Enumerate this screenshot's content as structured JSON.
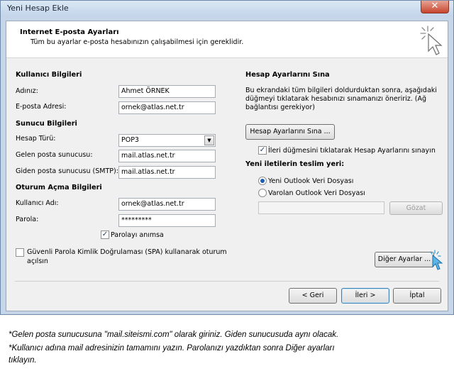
{
  "window": {
    "title": "Yeni Hesap Ekle",
    "close_glyph": "✕"
  },
  "header": {
    "title": "Internet E-posta Ayarları",
    "subtitle": "Tüm bu ayarlar e-posta hesabınızın çalışabilmesi için gereklidir."
  },
  "user_info": {
    "heading": "Kullanıcı Bilgileri",
    "name_label": "Adınız:",
    "name_value": "Ahmet ÖRNEK",
    "email_label": "E-posta Adresi:",
    "email_value": "ornek@atlas.net.tr"
  },
  "server_info": {
    "heading": "Sunucu Bilgileri",
    "account_type_label": "Hesap Türü:",
    "account_type_value": "POP3",
    "incoming_label": "Gelen posta sunucusu:",
    "incoming_value": "mail.atlas.net.tr",
    "outgoing_label": "Giden posta sunucusu (SMTP):",
    "outgoing_value": "mail.atlas.net.tr"
  },
  "logon_info": {
    "heading": "Oturum Açma Bilgileri",
    "username_label": "Kullanıcı Adı:",
    "username_value": "ornek@atlas.net.tr",
    "password_label": "Parola:",
    "password_value": "*********",
    "remember_label": "Parolayı anımsa",
    "remember_checked": true,
    "spa_label_line1": "Güvenli Parola Kimlik Doğrulaması (SPA) kullanarak oturum",
    "spa_label_line2": "açılsın",
    "spa_checked": false
  },
  "test_settings": {
    "heading": "Hesap Ayarlarını Sına",
    "desc_line1": "Bu ekrandaki tüm bilgileri doldurduktan sonra, aşağıdaki",
    "desc_line2": "düğmeyi tıklatarak hesabınızı sınamanızı öneririz. (Ağ",
    "desc_line3": "bağlantısı gerekiyor)",
    "test_button": "Hesap Ayarlarını Sına ...",
    "auto_test_label": "İleri düğmesini tıklatarak Hesap Ayarlarını sınayın",
    "auto_test_checked": true
  },
  "delivery": {
    "heading": "Yeni iletilerin teslim yeri:",
    "option_new": "Yeni Outlook Veri Dosyası",
    "option_existing": "Varolan Outlook Veri Dosyası",
    "selected": "new",
    "path_value": "",
    "browse_button": "Gözat"
  },
  "more_settings_button": "Diğer Ayarlar ...",
  "nav": {
    "back": "< Geri",
    "next": "İleri >",
    "cancel": "İptal"
  },
  "instructions": {
    "line1": "*Gelen posta sunucusuna \"mail.siteismi.com\" olarak giriniz. Giden sunucusuda aynı olacak.",
    "line2": "*Kullanıcı adına mail adresinizin tamamını yazın. Parolanızı yazdıktan sonra Diğer ayarları",
    "line3": "tıklayın."
  },
  "icons": [
    "close-icon",
    "wizard-cursor-icon",
    "dropdown-arrow-icon",
    "checkmark-icon",
    "pointer-cursor-icon"
  ]
}
